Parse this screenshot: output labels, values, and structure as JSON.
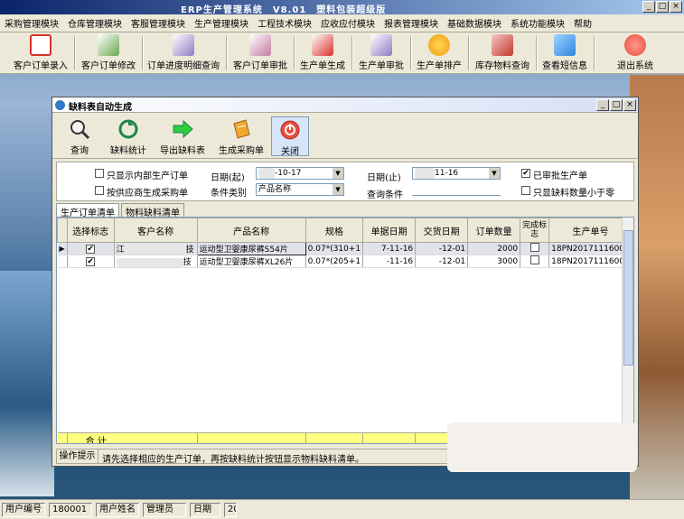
{
  "app": {
    "title": "ERP生产管理系统　V8.01　塑料包装超级版",
    "win_controls": [
      "_",
      "□",
      "×"
    ]
  },
  "menu": [
    "采购管理模块",
    "仓库管理模块",
    "客服管理模块",
    "生产管理模块",
    "工程技术模块",
    "应收应付模块",
    "报表管理模块",
    "基础数据模块",
    "系统功能模块",
    "帮助"
  ],
  "toolbar": [
    {
      "label": "客户订单录入",
      "icon": "pdf-order-icon",
      "color": "#d9322b"
    },
    {
      "label": "客户订单修改",
      "icon": "edit-order-icon",
      "color": "#6aa84f"
    },
    {
      "label": "订单进度明细查询",
      "icon": "progress-icon",
      "color": "#8e7cc3"
    },
    {
      "label": "客户订单审批",
      "icon": "approve-icon",
      "color": "#c27ba0"
    },
    {
      "label": "生产单生成",
      "icon": "generate-icon",
      "color": "#d9322b"
    },
    {
      "label": "生产单审批",
      "icon": "production-approve-icon",
      "color": "#8e7cc3"
    },
    {
      "label": "生产单排产",
      "icon": "schedule-icon",
      "color": "#f39c12"
    },
    {
      "label": "库存物料查询",
      "icon": "inventory-icon",
      "color": "#c0392b"
    },
    {
      "label": "查看短信息",
      "icon": "message-icon",
      "color": "#2e86de"
    },
    {
      "label": "退出系统",
      "icon": "exit-icon",
      "color": "#e74c3c"
    }
  ],
  "window": {
    "title": "缺料表自动生成",
    "buttons": [
      {
        "label": "查询",
        "icon": "search-icon"
      },
      {
        "label": "缺料统计",
        "icon": "stats-icon"
      },
      {
        "label": "导出缺料表",
        "icon": "export-icon"
      },
      {
        "label": "生成采购单",
        "icon": "purchase-icon"
      },
      {
        "label": "关闭",
        "icon": "close-icon"
      }
    ]
  },
  "filters": {
    "only_internal": "只显示内部生产订单",
    "by_supplier": "按供应商生成采购单",
    "date_from_label": "日期(起)",
    "date_from": "-10-17",
    "category_label": "条件类别",
    "category": "产品名称",
    "date_to_label": "日期(止)",
    "date_to": "11-16",
    "condition_label": "查询条件",
    "approved": "已审批生产单",
    "approved_checked": "✔",
    "only_negative": "只显缺料数量小于零"
  },
  "tabs": [
    "生产订单清单",
    "物料缺料清单"
  ],
  "grid": {
    "columns": [
      "选择标志",
      "客户名称",
      "产品名称",
      "规格",
      "单据日期",
      "交货日期",
      "订单数量",
      "完成标志",
      "生产单号"
    ],
    "rows": [
      {
        "check": "✔",
        "customer": "江",
        "customer2": "技",
        "product": "运动型卫婴康尿裤S54片",
        "spec": "0.07*(310+1",
        "doc_date": "7-11-16",
        "due_date": "-12-01",
        "qty": "2000",
        "done": "",
        "order_no": "18PN20171116001"
      },
      {
        "check": "✔",
        "customer": "",
        "customer2": "技",
        "product": "运动型卫婴康尿裤XL26片",
        "spec": "0.07*(205+1",
        "doc_date": "-11-16",
        "due_date": "-12-01",
        "qty": "3000",
        "done": "",
        "order_no": "18PN20171116002"
      }
    ],
    "total_label": "合  计"
  },
  "hint": {
    "label": "操作提示",
    "text": "请先选择相应的生产订单，再按缺料统计按钮显示物料缺料清单。"
  },
  "status": {
    "user_id_label": "用户编号",
    "user_id": "180001",
    "user_name_label": "用户姓名",
    "user_name": "管理员",
    "date_label": "日期",
    "date": "20"
  }
}
